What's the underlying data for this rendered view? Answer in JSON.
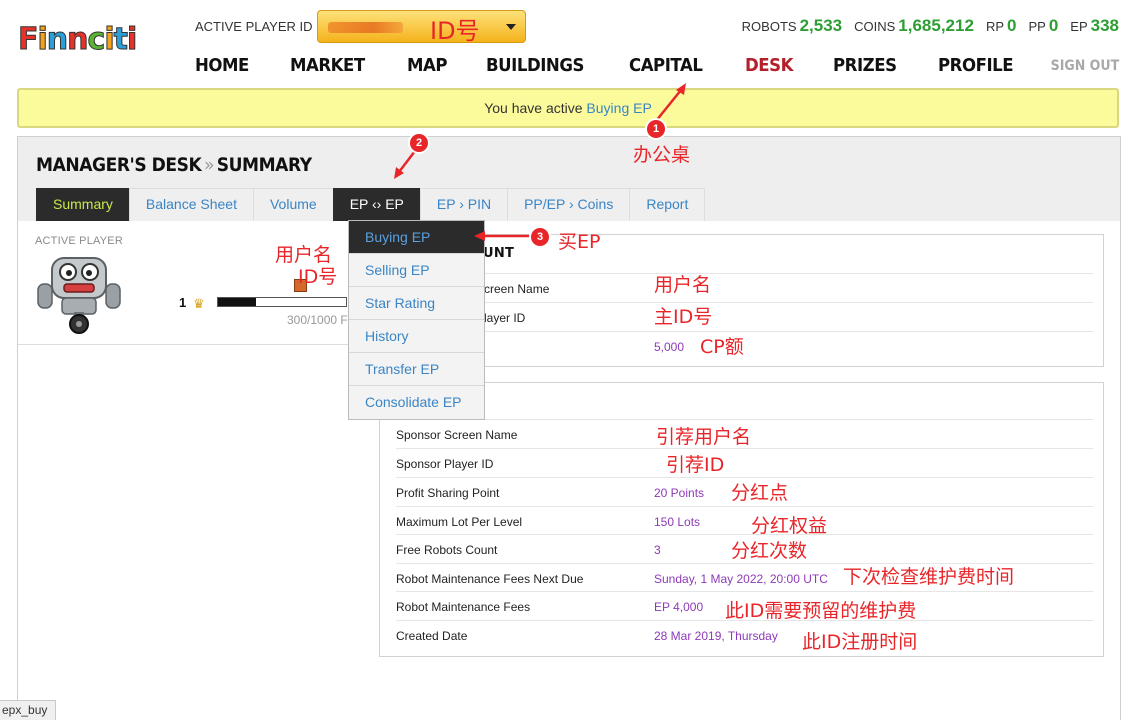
{
  "header": {
    "logo_letters": [
      "F",
      "i",
      "n",
      "n",
      "c",
      "i",
      "t",
      "i"
    ],
    "logo_colors": [
      "#e5332a",
      "#f2a21c",
      "#2c9fd8",
      "#e5332a",
      "#5bb431",
      "#f2a21c",
      "#2c9fd8",
      "#e5332a"
    ],
    "player_id_label": "ACTIVE PLAYER ID",
    "player_id_annotation": "ID号",
    "stats": [
      {
        "label": "ROBOTS",
        "value": "2,533"
      },
      {
        "label": "COINS",
        "value": "1,685,212"
      },
      {
        "label": "RP",
        "value": "0"
      },
      {
        "label": "PP",
        "value": "0"
      },
      {
        "label": "EP",
        "value": "338"
      }
    ],
    "nav": [
      "HOME",
      "MARKET",
      "MAP",
      "BUILDINGS",
      "CAPITAL",
      "DESK",
      "PRIZES",
      "PROFILE"
    ],
    "nav_active": "DESK",
    "signout": "SIGN OUT"
  },
  "notice": {
    "text": "You have active ",
    "link": "Buying EP"
  },
  "desk": {
    "title_main": "MANAGER'S DESK",
    "title_sep": "»",
    "title_sub": "SUMMARY",
    "tabs": [
      "Summary",
      "Balance Sheet",
      "Volume",
      "EP ‹› EP",
      "EP › PIN",
      "PP/EP › Coins",
      "Report"
    ]
  },
  "dropdown": {
    "items": [
      "Buying EP",
      "Selling EP",
      "Star Rating",
      "History",
      "Transfer EP",
      "Consolidate EP"
    ]
  },
  "player": {
    "label": "ACTIVE PLAYER",
    "level": "1",
    "level_progress_fraction": 0.3,
    "level_progress_text": "300/1000 F"
  },
  "account": {
    "title_visible": "UNT",
    "rows": [
      {
        "label": "creen Name",
        "value": ""
      },
      {
        "label": "layer ID",
        "value": ""
      },
      {
        "label": "",
        "value": "5,000"
      }
    ]
  },
  "sponsor": {
    "rows": [
      {
        "label": "Sponsor Screen Name",
        "value": ""
      },
      {
        "label": "Sponsor Player ID",
        "value": ""
      },
      {
        "label": "Profit Sharing Point",
        "value": "20 Points"
      },
      {
        "label": "Maximum Lot Per Level",
        "value": "150 Lots"
      },
      {
        "label": "Free Robots Count",
        "value": "3"
      },
      {
        "label": "Robot Maintenance Fees Next Due",
        "value": "Sunday, 1 May 2022, 20:00 UTC"
      },
      {
        "label": "Robot Maintenance Fees",
        "value": "EP 4,000"
      },
      {
        "label": "Created Date",
        "value": "28 Mar 2019, Thursday"
      }
    ]
  },
  "annotations": {
    "badge_1": "1",
    "badge_2": "2",
    "badge_3": "3",
    "desk": "办公桌",
    "buy_ep": "买EP",
    "username_left": "用户名",
    "id_left": "ID号",
    "account_username": "用户名",
    "account_main_id": "主ID号",
    "account_cp": "CP额",
    "sponsor_username": "引荐用户名",
    "sponsor_id": "引荐ID",
    "profit_point": "分红点",
    "profit_rights": "分红权益",
    "profit_count": "分红次数",
    "next_due": "下次检查维护费时间",
    "fees": "此ID需要预留的维护费",
    "created": "此ID注册时间",
    "color": "#e8262a"
  },
  "statusbar": "epx_buy"
}
